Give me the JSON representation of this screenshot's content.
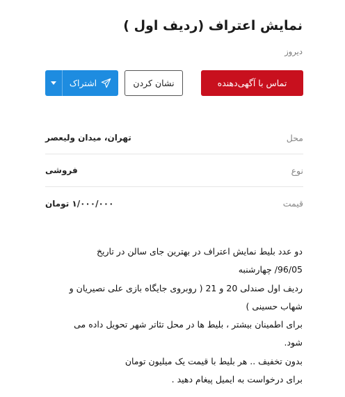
{
  "header": {
    "title": "نمایش اعتراف (ردیف اول )",
    "posted": "دیروز"
  },
  "actions": {
    "contact_label": "تماس با آگهی‌دهنده",
    "bookmark_label": "نشان کردن",
    "share_label": "اشتراک"
  },
  "details": [
    {
      "label": "محل",
      "value": "تهران، میدان ولیعصر"
    },
    {
      "label": "نوع",
      "value": "فروشی"
    },
    {
      "label": "قیمت",
      "value": "۱/۰۰۰/۰۰۰ تومان"
    }
  ],
  "description": [
    "دو عدد بلیط نمایش اعتراف در بهترین جای سالن در تاریخ",
    "96/05/ چهارشنبه",
    "ردیف اول صندلی 20 و 21 ( روبروی جایگاه بازی علی نصیریان و",
    "شهاب حسینی )",
    "برای اطمینان بیشتر ، بلیط ها در محل تئاتر شهر تحویل داده می",
    "شود.",
    "بدون تخفیف .. هر بلیط با قیمت یک میلیون تومان",
    "برای درخواست به ایمیل پیغام دهید ."
  ],
  "colors": {
    "contact_button": "#c8101e",
    "share_button": "#1e8ce0"
  },
  "icons": {
    "share": "paper-plane-icon",
    "dropdown": "caret-down-icon"
  }
}
